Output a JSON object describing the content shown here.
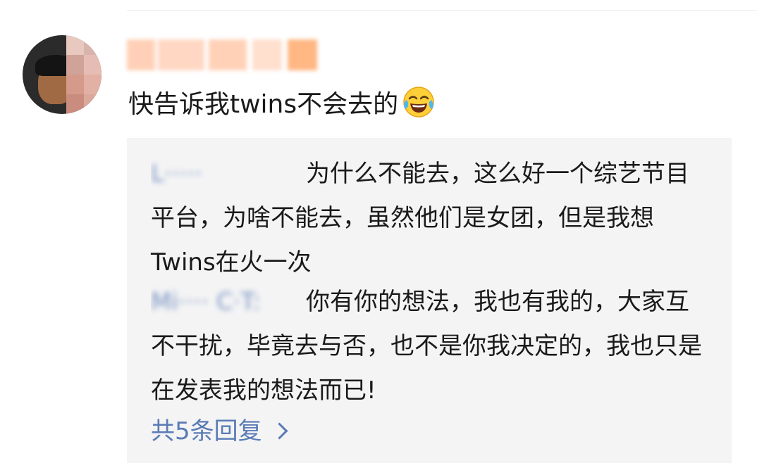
{
  "comment": {
    "username": "",
    "text": "快告诉我twins不会去的",
    "emoji": "tears-of-joy-emoji"
  },
  "replies": [
    {
      "author": "L·····",
      "text": "为什么不能去，这么好一个综艺节目平台，为啥不能去，虽然他们是女团，但是我想Twins在火一次"
    },
    {
      "author": "Mi···· C·T:",
      "text": " 你有你的想法，我也有我的，大家互不干扰，毕竟去与否，也不是你我决定的，我也只是在发表我的想法而已!"
    }
  ],
  "more_replies": {
    "label": "共5条回复",
    "icon": "chevron-right-icon"
  },
  "colors": {
    "link": "#5a7bb5",
    "reply_bg": "#f4f4f5",
    "text": "#1a1a1a"
  }
}
